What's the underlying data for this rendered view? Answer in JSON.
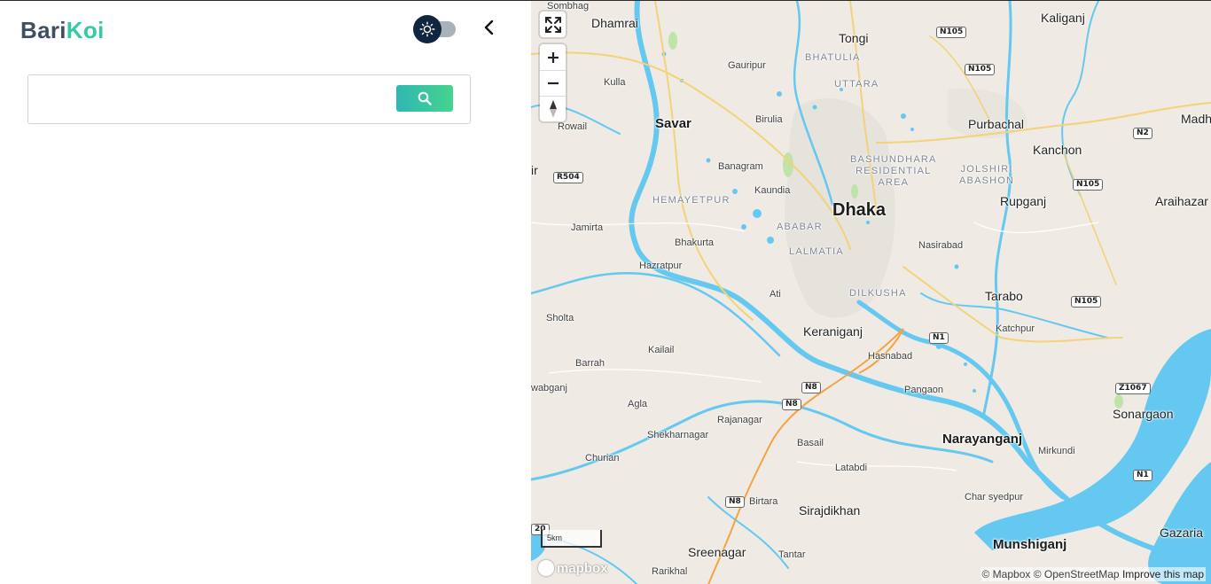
{
  "sidebar": {
    "logo": {
      "part1": "Bari",
      "part2": "Koi"
    },
    "search": {
      "placeholder": "",
      "value": ""
    }
  },
  "icons": {
    "theme": "sun-icon",
    "collapse": "chevron-left-icon",
    "search": "search-icon",
    "fullscreen": "fullscreen-icon",
    "zoom_in": "plus-icon",
    "zoom_out": "minus-icon",
    "compass": "compass-icon"
  },
  "colors": {
    "logo_dark": "#3e4e63",
    "logo_accent": "#35c9a5",
    "toggle_knob": "#0f2540",
    "search_button_start": "#2fb7b3",
    "search_button_end": "#45d48c",
    "water": "#64c8f0",
    "land": "#efebe4"
  },
  "map": {
    "scale_label": "5km",
    "logo_text": "mapbox",
    "attribution": {
      "mapbox": "© Mapbox",
      "osm": "© OpenStreetMap",
      "improve": "Improve this map"
    },
    "labels": {
      "dhaka": "Dhaka",
      "savar": "Savar",
      "narayanganj": "Narayanganj",
      "munshiganj": "Munshiganj",
      "tongi": "Tongi",
      "keraniganj": "Keraniganj",
      "purbachal": "Purbachal",
      "kanchon": "Kanchon",
      "rupganj": "Rupganj",
      "tarabo": "Tarabo",
      "sonargaon": "Sonargaon",
      "araihazar": "Araihazar",
      "kaliganj": "Kaliganj",
      "dhamrai": "Dhamrai",
      "sombhag": "Sombhag",
      "gauripur": "Gauripur",
      "kulla": "Kulla",
      "birulia": "Birulia",
      "rowail": "Rowail",
      "banagram": "Banagram",
      "kaundia": "Kaundia",
      "jamirta": "Jamirta",
      "bhakurta": "Bhakurta",
      "hazratpur": "Hazratpur",
      "ati": "Ati",
      "sholta": "Sholta",
      "kailail": "Kailail",
      "barrah": "Barrah",
      "nawabganj": "wabganj",
      "agla": "Agla",
      "rajanagar": "Rajanagar",
      "shekharnagar": "Shekharnagar",
      "churian": "Churian",
      "basail": "Basail",
      "latabdi": "Latabdi",
      "birtara": "Birtara",
      "sirajdikhan": "Sirajdikhan",
      "sreenagar": "Sreenagar",
      "tantar": "Tantar",
      "rarikhal": "Rarikhal",
      "hasnabad": "Hasnabad",
      "pangaon": "Pangaon",
      "nasirabad": "Nasirabad",
      "katchpur": "Katchpur",
      "mirkundi": "Mirkundi",
      "char_syedpur": "Char syedpur",
      "gazaria": "Gazaria",
      "madh": "Madh",
      "ir": "ir",
      "bhatulia": "BHATULIA",
      "uttara": "UTTARA",
      "bashundhara": "BASHUNDHARA\nRESIDENTIAL\nAREA",
      "jolshiri": "JOLSHIRI\nABASHON",
      "hemayetpur": "HEMAYETPUR",
      "ababar": "ABABAR",
      "lalmatia": "LALMATIA",
      "dilkusha": "DILKUSHA"
    },
    "shields": {
      "n105_a": "N105",
      "n105_b": "N105",
      "n105_c": "N105",
      "n105_d": "N105",
      "n2": "N2",
      "r504": "R504",
      "n1_a": "N1",
      "n1_b": "N1",
      "n8_a": "N8",
      "n8_b": "N8",
      "n8_c": "N8",
      "z1067": "Z1067",
      "r20": "20"
    }
  }
}
